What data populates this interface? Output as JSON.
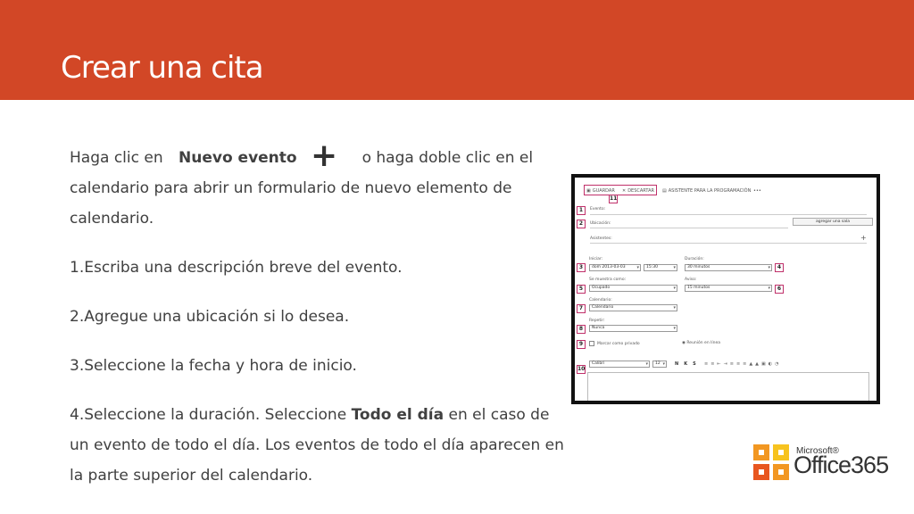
{
  "header": {
    "title": "Crear una cita",
    "color": "#d24726"
  },
  "content": {
    "intro_a": "Haga clic en",
    "intro_bold": "Nuevo evento",
    "intro_icon": "plus-icon",
    "intro_b": "o haga doble clic en el calendario para abrir un formulario de nuevo elemento de calendario.",
    "step1": "1.Escriba una descripción breve del evento.",
    "step2": "2.Agregue una ubicación si lo desea.",
    "step3": "3.Seleccione la fecha y hora de inicio.",
    "step4_a": "4.Seleccione la duración. Seleccione",
    "step4_bold": "Todo el día",
    "step4_b": "en el caso de un evento de todo el día. Los eventos de todo el día aparecen en la parte superior del calendario."
  },
  "screenshot": {
    "toolbar": {
      "save": "GUARDAR",
      "discard": "DESCARTAR",
      "assistant": "ASISTENTE PARA LA PROGRAMACIÓN",
      "more": "•••"
    },
    "labels": {
      "event": "Evento:",
      "location": "Ubicación:",
      "attendees": "Asistentes:",
      "start": "Iniciar:",
      "duration": "Duración:",
      "show_as": "Se muestra como:",
      "reminder": "Aviso:",
      "calendar": "Calendario:",
      "repeat": "Repetir:",
      "private": "Marcar como privado",
      "online": "Reunión en línea"
    },
    "add_room": "agregar una sala",
    "attendees_plus": "+",
    "values": {
      "start_date": "dom 2013-03-03",
      "start_time": "15:30",
      "duration": "30 minutos",
      "show_as": "Ocupado",
      "reminder": "15 minutos",
      "calendar": "Calendario",
      "repeat": "Nunca",
      "font": "Calibri",
      "font_size": "12"
    },
    "format_buttons": [
      "N",
      "K",
      "S"
    ],
    "numbers": [
      "1",
      "2",
      "3",
      "4",
      "5",
      "6",
      "7",
      "8",
      "9",
      "10",
      "11"
    ]
  },
  "logo": {
    "brand": "Microsoft®",
    "product": "Office",
    "version": "365"
  }
}
